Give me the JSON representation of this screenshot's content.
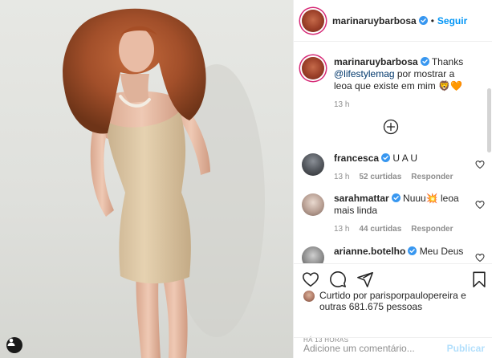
{
  "post": {
    "author": "marinaruybarbosa",
    "follow_label": "Seguir",
    "separator": "•"
  },
  "caption": {
    "author": "marinaruybarbosa",
    "text_before": "Thanks ",
    "mention": "@lifestylemag",
    "text_after": " por mostrar a leoa que existe em mim 🦁🧡",
    "time": "13 h"
  },
  "comments": [
    {
      "author": "francesca",
      "text": "U A U",
      "time": "13 h",
      "likes": "52 curtidas",
      "reply": "Responder"
    },
    {
      "author": "sarahmattar",
      "text": "Nuuu💥 leoa mais linda",
      "time": "13 h",
      "likes": "44 curtidas",
      "reply": "Responder"
    },
    {
      "author": "arianne.botelho",
      "text": "Meu Deus"
    }
  ],
  "likes": {
    "prefix": "Curtido por ",
    "user": "parisporpaulopereira",
    "middle": " e outras ",
    "count": "681.675",
    "suffix": " pessoas"
  },
  "timestamp": "HÁ 13 HORAS",
  "comment_input": {
    "placeholder": "Adicione um comentário...",
    "publish_label": "Publicar"
  },
  "icons": {
    "verified": "verified-badge-icon",
    "like": "heart-icon",
    "comment": "comment-icon",
    "share": "send-icon",
    "save": "bookmark-icon",
    "tag": "user-tag-icon",
    "more": "plus-circle-icon"
  },
  "colors": {
    "link": "#0095f6",
    "verified": "#3897f0",
    "muted": "#8e8e8e",
    "publish_disabled": "#b2dffc"
  }
}
